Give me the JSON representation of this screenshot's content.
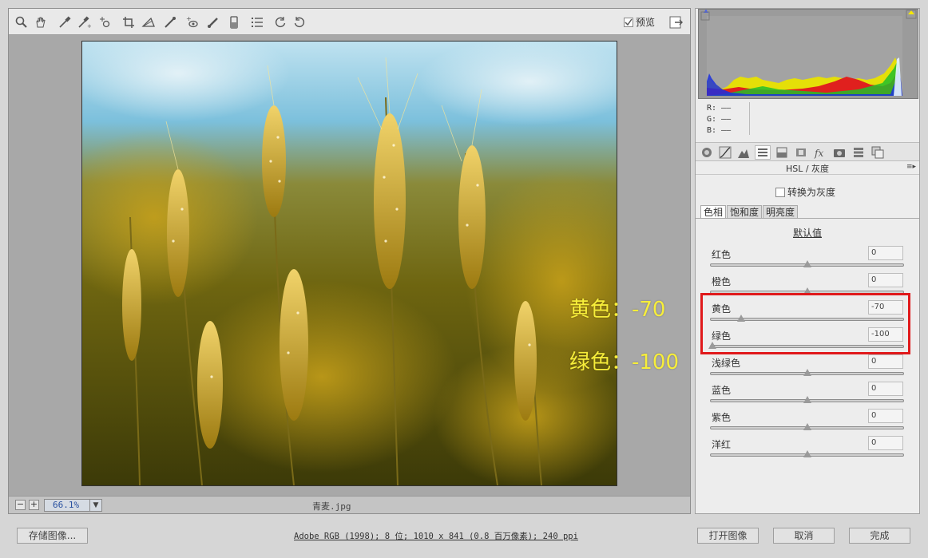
{
  "toolbar": {
    "tools": [
      "zoom-icon",
      "hand-icon",
      "white-balance-icon",
      "color-sampler-icon",
      "target-adjust-icon",
      "crop-icon",
      "straighten-icon",
      "spot-removal-icon",
      "red-eye-icon",
      "adjustment-brush-icon",
      "graduated-filter-icon",
      "preferences-icon",
      "rotate-left-icon",
      "rotate-right-icon"
    ],
    "preview_label": "预览",
    "preview_checked": true
  },
  "annotations": {
    "yellow": "黄色：-70",
    "green": "绿色：-100",
    "color": "#f7ee3a"
  },
  "statusbar": {
    "zoom": "66.1%",
    "filename": "青麦.jpg"
  },
  "readout": {
    "r": "R:  ——",
    "g": "G:  ——",
    "b": "B:  ——"
  },
  "panel": {
    "title": "HSL / 灰度",
    "convert_gray_label": "转换为灰度",
    "tabs": [
      "色相",
      "饱和度",
      "明亮度"
    ],
    "active_tab": 0,
    "defaults_label": "默认值",
    "sliders": [
      {
        "label": "红色",
        "value": "0",
        "num": 0
      },
      {
        "label": "橙色",
        "value": "0",
        "num": 0
      },
      {
        "label": "黄色",
        "value": "-70",
        "num": -70
      },
      {
        "label": "绿色",
        "value": "-100",
        "num": -100
      },
      {
        "label": "浅绿色",
        "value": "0",
        "num": 0
      },
      {
        "label": "蓝色",
        "value": "0",
        "num": 0
      },
      {
        "label": "紫色",
        "value": "0",
        "num": 0
      },
      {
        "label": "洋红",
        "value": "0",
        "num": 0
      }
    ],
    "slider_range": [
      -100,
      100
    ]
  },
  "bottom": {
    "save_label": "存储图像...",
    "workflow": "Adobe RGB (1998); 8 位; 1010 x 841 (0.8 百万像素); 240 ppi",
    "open_label": "打开图像",
    "cancel_label": "取消",
    "done_label": "完成"
  },
  "highlight_color": "#e0191b"
}
